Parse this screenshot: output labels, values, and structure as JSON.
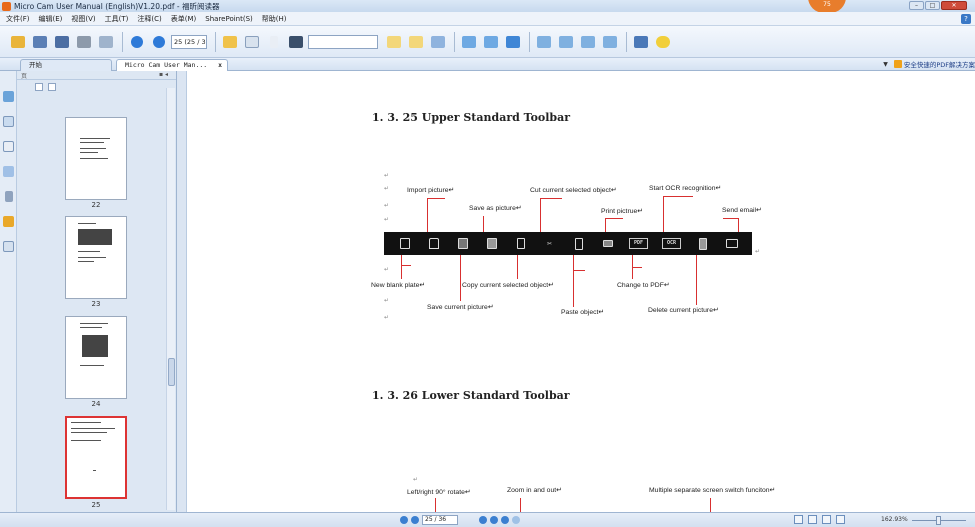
{
  "window": {
    "title": "Micro Cam User Manual (English)V1.20.pdf - 福昕阅读器",
    "cloud_badge": "75"
  },
  "menu": [
    "文件(F)",
    "编辑(E)",
    "视图(V)",
    "工具(T)",
    "注释(C)",
    "表单(M)",
    "SharePoint(S)",
    "帮助(H)"
  ],
  "toolbar": {
    "page_field": "25 (25 / 36)",
    "search_placeholder": ""
  },
  "tabs": {
    "start": "开始",
    "document": "Micro Cam User Man...",
    "close": "x"
  },
  "ad_link": "安全快速的PDF解决方案",
  "thumbs": {
    "header": "页",
    "pages": [
      "22",
      "23",
      "24",
      "25"
    ],
    "selected_page": "25"
  },
  "document": {
    "heading1": "1. 3. 25  Upper Standard Toolbar",
    "heading2": "1. 3. 26  Lower Standard Toolbar",
    "mark": "↵",
    "upper_labels": {
      "import_picture": "Import picture↵",
      "save_as_picture": "Save as picture↵",
      "cut_current": "Cut current selected object↵",
      "start_ocr": "Start OCR recognition↵",
      "print_pictrue": "Print pictrue↵",
      "send_email": "Send email↵",
      "new_blank_plate": "New blank plate↵",
      "copy_current": "Copy current selected object↵",
      "change_to_pdf": "Change to PDF↵",
      "save_current": "Save current picture↵",
      "paste_object": "Paste object↵",
      "delete_current": "Delete current picture↵"
    },
    "lower_labels": {
      "left_right_rotate": "Left/right 90° rotate↵",
      "zoom_in_out": "Zoom in and out↵",
      "multi_screen": "Multiple separate screen switch funciton↵"
    },
    "toolbar_icons": {
      "pdf": "PDF",
      "ocr": "OCR"
    }
  },
  "status": {
    "page_field": "25 / 36",
    "zoom": "162.93%"
  }
}
